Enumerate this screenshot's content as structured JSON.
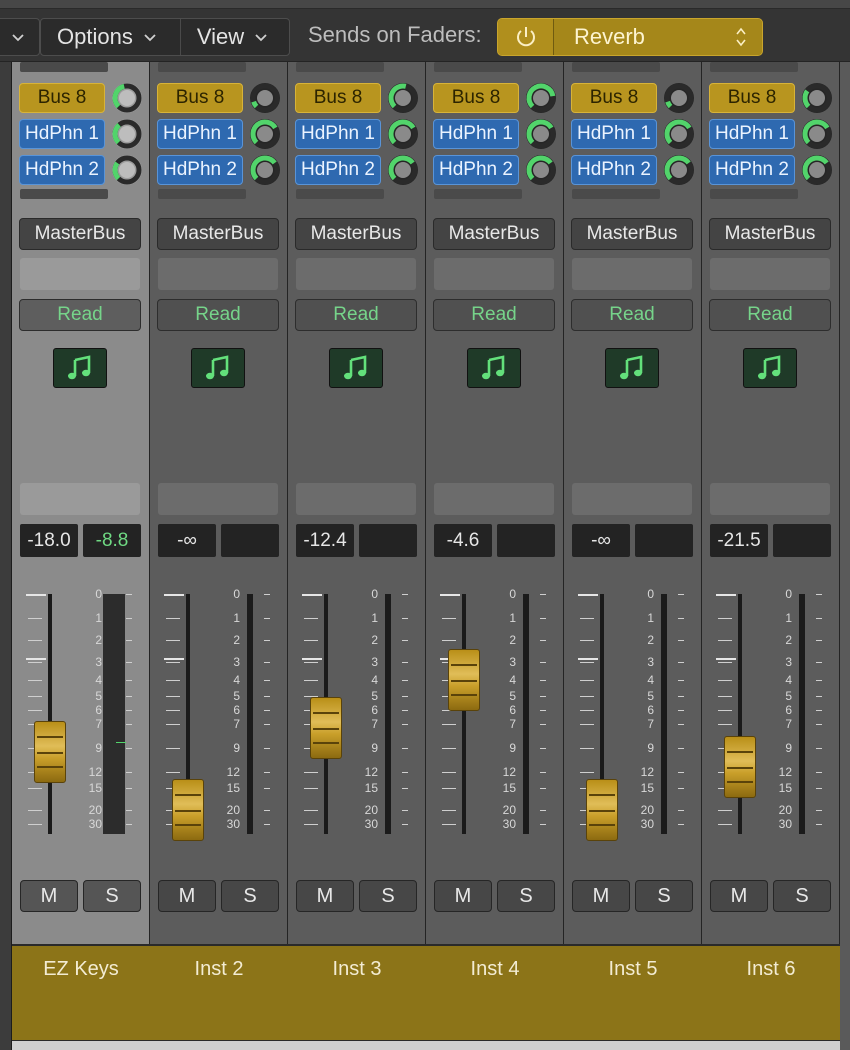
{
  "toolbar": {
    "menus": [
      {
        "label": ""
      },
      {
        "label": "Options"
      },
      {
        "label": "View"
      }
    ],
    "sends_label": "Sends on Faders:",
    "sends_target": "Reverb",
    "colors": {
      "accent": "#a3861a",
      "send_bus": "#b8951f",
      "send_hdphn": "#2e69b0",
      "automation": "#76d48a"
    }
  },
  "scale_labels": [
    "0",
    "1",
    "2",
    "3",
    "4",
    "5",
    "6",
    "7",
    "9",
    "12",
    "15",
    "20",
    "30"
  ],
  "channels": [
    {
      "name": "EZ Keys",
      "sends": [
        "Bus 8",
        "HdPhn 1",
        "HdPhn 2"
      ],
      "send_levels": [
        0.45,
        0.35,
        0.3
      ],
      "output": "MasterBus",
      "automation": "Read",
      "icon": "music-note-icon",
      "volume": "-18.0",
      "peak": "-8.8",
      "fader_position": 0.66,
      "mute": "M",
      "solo": "S",
      "selected": true
    },
    {
      "name": "Inst 2",
      "sends": [
        "Bus 8",
        "HdPhn 1",
        "HdPhn 2"
      ],
      "send_levels": [
        0.1,
        0.72,
        0.7
      ],
      "output": "MasterBus",
      "automation": "Read",
      "icon": "music-note-icon",
      "volume": "-∞",
      "peak": "",
      "fader_position": 0.9,
      "mute": "M",
      "solo": "S",
      "selected": false
    },
    {
      "name": "Inst 3",
      "sends": [
        "Bus 8",
        "HdPhn 1",
        "HdPhn 2"
      ],
      "send_levels": [
        0.55,
        0.72,
        0.7
      ],
      "output": "MasterBus",
      "automation": "Read",
      "icon": "music-note-icon",
      "volume": "-12.4",
      "peak": "",
      "fader_position": 0.56,
      "mute": "M",
      "solo": "S",
      "selected": false
    },
    {
      "name": "Inst 4",
      "sends": [
        "Bus 8",
        "HdPhn 1",
        "HdPhn 2"
      ],
      "send_levels": [
        0.8,
        0.72,
        0.7
      ],
      "output": "MasterBus",
      "automation": "Read",
      "icon": "music-note-icon",
      "volume": "-4.6",
      "peak": "",
      "fader_position": 0.36,
      "mute": "M",
      "solo": "S",
      "selected": false
    },
    {
      "name": "Inst 5",
      "sends": [
        "Bus 8",
        "HdPhn 1",
        "HdPhn 2"
      ],
      "send_levels": [
        0.1,
        0.72,
        0.7
      ],
      "output": "MasterBus",
      "automation": "Read",
      "icon": "music-note-icon",
      "volume": "-∞",
      "peak": "",
      "fader_position": 0.9,
      "mute": "M",
      "solo": "S",
      "selected": false
    },
    {
      "name": "Inst 6",
      "sends": [
        "Bus 8",
        "HdPhn 1",
        "HdPhn 2"
      ],
      "send_levels": [
        0.3,
        0.72,
        0.7
      ],
      "output": "MasterBus",
      "automation": "Read",
      "icon": "music-note-icon",
      "volume": "-21.5",
      "peak": "",
      "fader_position": 0.72,
      "mute": "M",
      "solo": "S",
      "selected": false
    }
  ]
}
